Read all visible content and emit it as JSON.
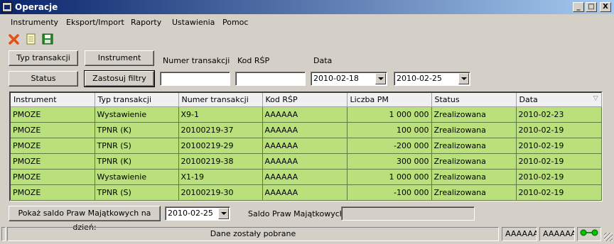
{
  "window": {
    "title": "Operacje",
    "controls": {
      "minimize": "_",
      "maximize": "□",
      "close": "X"
    }
  },
  "menu": [
    "Instrumenty",
    "Eksport/Import",
    "Raporty",
    "Ustawienia",
    "Pomoc"
  ],
  "toolbar": {
    "icons": [
      "delete-icon",
      "document-icon",
      "save-icon"
    ],
    "colors": {
      "delete": "#e0501a",
      "save": "#2a8a2a"
    }
  },
  "filters": {
    "buttons": {
      "transaction_type": "Typ transakcji",
      "instrument": "Instrument",
      "status": "Status",
      "apply": "Zastosuj filtry"
    },
    "labels": {
      "transaction_number": "Numer transakcji",
      "rsp_code": "Kod RŚP",
      "date": "Data"
    },
    "values": {
      "transaction_number": "",
      "rsp_code": "",
      "date_from": "2010-02-18",
      "date_to": "2010-02-25"
    }
  },
  "table": {
    "columns": [
      "Instrument",
      "Typ transakcji",
      "Numer transakcji",
      "Kod RŚP",
      "Liczba PM",
      "Status",
      "Data"
    ],
    "rows": [
      [
        "PMOZE",
        "Wystawienie",
        "X9-1",
        "AAAAAA",
        "1 000 000",
        "Zrealizowana",
        "2010-02-23"
      ],
      [
        "PMOZE",
        "TPNR (K)",
        "20100219-37",
        "AAAAAA",
        "100 000",
        "Zrealizowana",
        "2010-02-19"
      ],
      [
        "PMOZE",
        "TPNR (S)",
        "20100219-29",
        "AAAAAA",
        "-200 000",
        "Zrealizowana",
        "2010-02-19"
      ],
      [
        "PMOZE",
        "TPNR (K)",
        "20100219-38",
        "AAAAAA",
        "300 000",
        "Zrealizowana",
        "2010-02-19"
      ],
      [
        "PMOZE",
        "Wystawienie",
        "X1-19",
        "AAAAAA",
        "1 000 000",
        "Zrealizowana",
        "2010-02-19"
      ],
      [
        "PMOZE",
        "TPNR (S)",
        "20100219-30",
        "AAAAAA",
        "-100 000",
        "Zrealizowana",
        "2010-02-19"
      ]
    ],
    "row_color": "#b9e07a"
  },
  "balance": {
    "button": "Pokaż saldo Praw Majątkowych na dzień:",
    "date": "2010-02-25",
    "label": "Saldo Praw Majątkowych:",
    "value": ""
  },
  "statusbar": {
    "message": "Dane zostały pobrane",
    "user1": "AAAAAA",
    "user2": "AAAAAA",
    "connection_color": "#00a000"
  }
}
